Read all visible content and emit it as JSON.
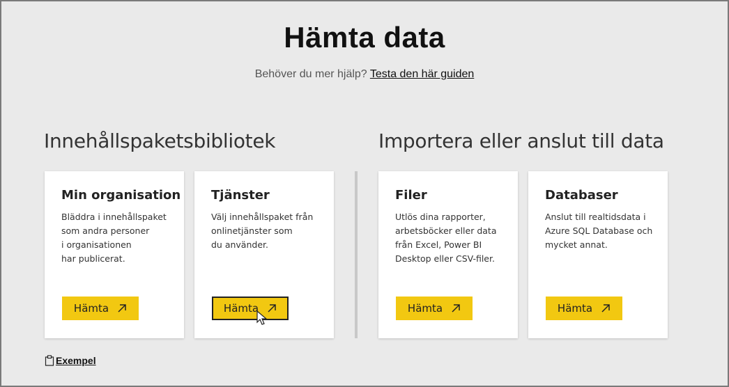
{
  "page": {
    "title": "Hämta data",
    "help_text": "Behöver du mer hjälp?",
    "help_link": "Testa den här guiden"
  },
  "sections": {
    "left_title": "Innehållspaketsbibliotek",
    "right_title": "Importera eller anslut till data"
  },
  "cards": [
    {
      "title": "Min organisation",
      "description": "Bläddra i innehållspaket\nsom andra personer\ni organisationen\nhar publicerat.",
      "button_label": "Hämta"
    },
    {
      "title": "Tjänster",
      "description": "Välj innehållspaket från\nonlinetjänster som\ndu använder.",
      "button_label": "Hämta"
    },
    {
      "title": "Filer",
      "description": "Utlös dina rapporter,\narbetsböcker eller data\nfrån Excel, Power BI\nDesktop eller CSV-filer.",
      "button_label": "Hämta"
    },
    {
      "title": "Databaser",
      "description": "Anslut till realtidsdata i\nAzure SQL Database och\nmycket annat.",
      "button_label": "Hämta"
    }
  ],
  "footer": {
    "example_link": "Exempel"
  },
  "icons": {
    "button_icon": "arrow-up-right-icon",
    "example_icon": "clipboard-icon"
  },
  "colors": {
    "accent": "#f2c811",
    "background": "#eaeaea",
    "card": "#ffffff"
  }
}
